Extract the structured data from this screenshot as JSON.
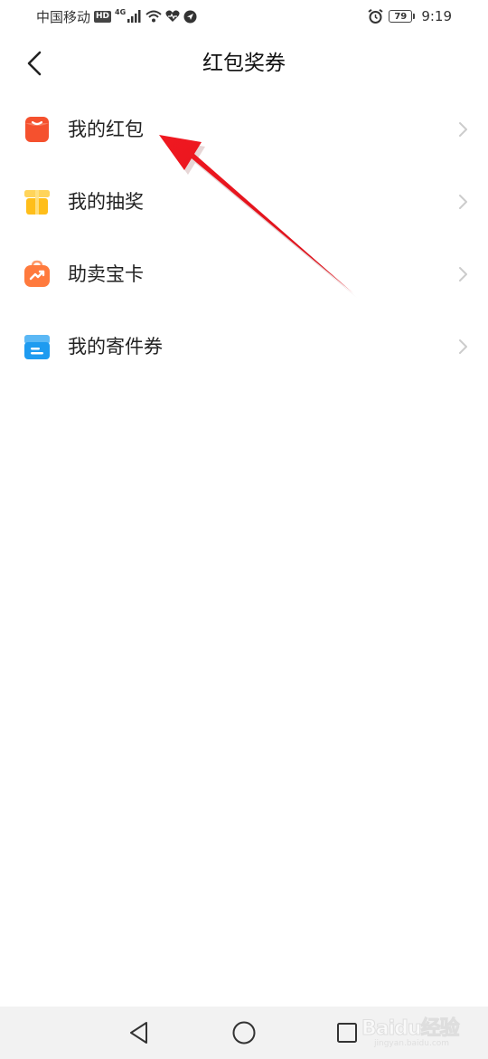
{
  "status_bar": {
    "carrier": "中国移动",
    "hd": "HD",
    "network": "4G",
    "battery": "79",
    "time": "9:19"
  },
  "header": {
    "title": "红包奖券",
    "back_icon": "chevron-left-icon"
  },
  "menu": {
    "items": [
      {
        "label": "我的红包",
        "icon": "red-envelope-icon",
        "color": "#F5512E"
      },
      {
        "label": "我的抽奖",
        "icon": "gift-box-icon",
        "color": "#FFBE1A"
      },
      {
        "label": "助卖宝卡",
        "icon": "trend-up-bag-icon",
        "color": "#FF7A3D"
      },
      {
        "label": "我的寄件券",
        "icon": "parcel-box-icon",
        "color": "#1E9BF0"
      }
    ]
  },
  "nav_bar": {
    "back_icon": "triangle-back-icon",
    "home_icon": "circle-home-icon",
    "recent_icon": "square-recent-icon"
  },
  "watermark": {
    "text": "Baidu经验",
    "sub": "jingyan.baidu.com"
  },
  "colors": {
    "annotation_arrow": "#E8141C",
    "title_text": "#111111",
    "chevron": "#CCCCCC",
    "nav_bg": "#F2F2F2"
  }
}
